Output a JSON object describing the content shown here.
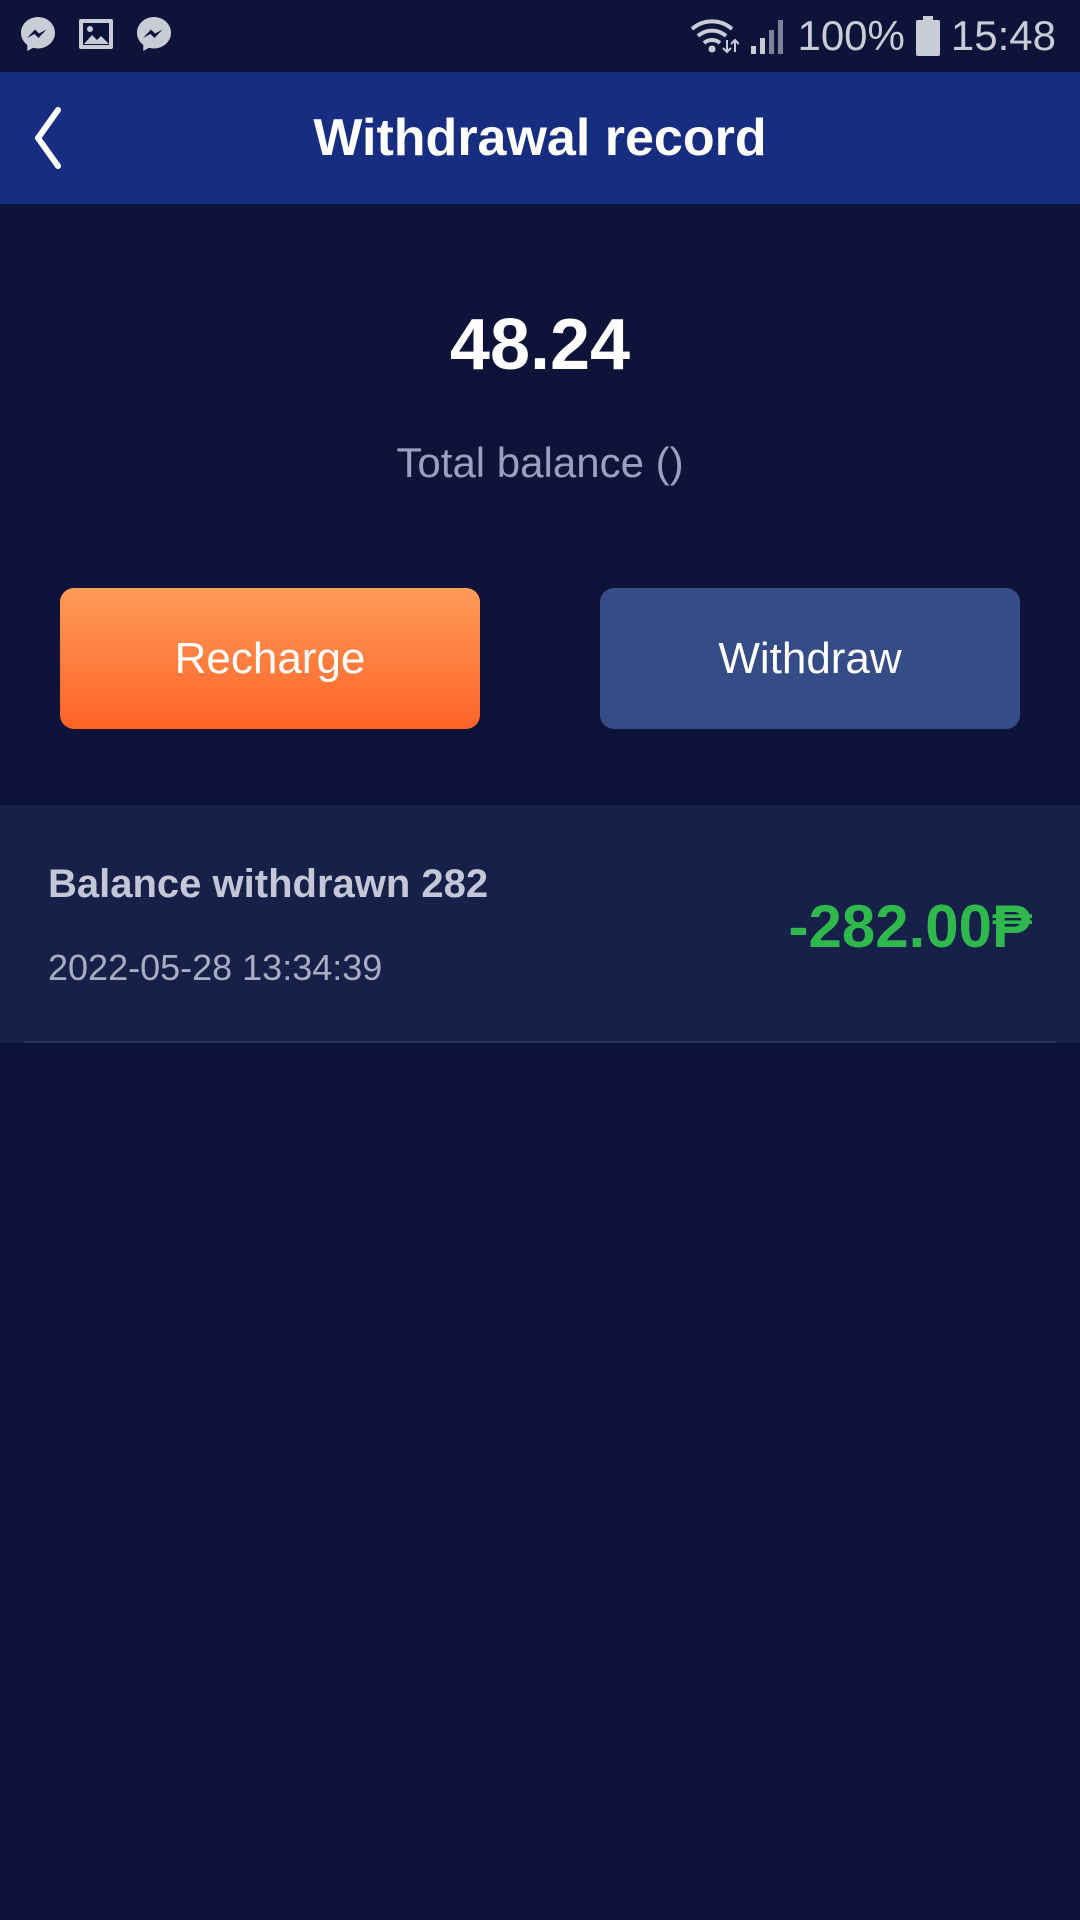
{
  "status_bar": {
    "notification_icons": [
      "messenger-icon",
      "gallery-icon",
      "messenger-icon"
    ],
    "battery": "100%",
    "time": "15:48"
  },
  "header": {
    "back_icon": "chevron-left-icon",
    "title": "Withdrawal record"
  },
  "balance": {
    "amount": "48.24",
    "label": "Total balance ()"
  },
  "actions": {
    "recharge_label": "Recharge",
    "withdraw_label": "Withdraw"
  },
  "records": [
    {
      "title": "Balance withdrawn 282",
      "date": "2022-05-28 13:34:39",
      "amount": "-282.00₱"
    }
  ],
  "colors": {
    "background": "#0e1439",
    "header": "#172d80",
    "recharge_button": "#ff7a3a",
    "withdraw_button": "#354c87",
    "record_card": "#172049",
    "amount_negative": "#2fb94c"
  }
}
